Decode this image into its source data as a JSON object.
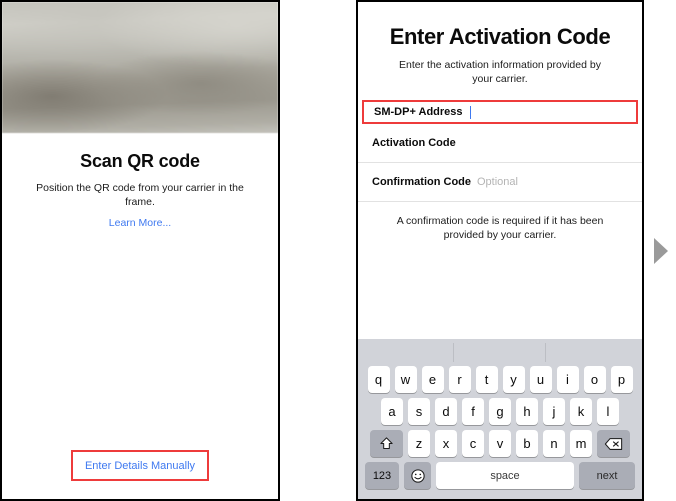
{
  "left_panel": {
    "camera": {
      "icon": "camera-preview",
      "alt": "blurred camera viewfinder"
    },
    "title": "Scan QR code",
    "description": "Position the QR code from your carrier in the frame.",
    "learn_more": "Learn More...",
    "manual_entry": "Enter Details Manually",
    "highlight_color": "#ee3b3b",
    "link_color": "#3f79f0"
  },
  "right_panel": {
    "title": "Enter Activation Code",
    "subtitle": "Enter the activation information provided by your carrier.",
    "fields": [
      {
        "label": "SM-DP+ Address",
        "value": "",
        "optional": "",
        "highlighted": true
      },
      {
        "label": "Activation Code",
        "value": "",
        "optional": "",
        "highlighted": false
      },
      {
        "label": "Confirmation Code",
        "value": "",
        "optional": "Optional",
        "highlighted": false
      }
    ],
    "note": "A confirmation code is required if it has been provided by your carrier.",
    "highlight_color": "#ee3b3b",
    "caret_color": "#3f79f0",
    "keyboard": {
      "suggestions": [
        "",
        "",
        ""
      ],
      "row1": [
        "q",
        "w",
        "e",
        "r",
        "t",
        "y",
        "u",
        "i",
        "o",
        "p"
      ],
      "row2": [
        "a",
        "s",
        "d",
        "f",
        "g",
        "h",
        "j",
        "k",
        "l"
      ],
      "row3": [
        "z",
        "x",
        "c",
        "v",
        "b",
        "n",
        "m"
      ],
      "shift_key": "shift-icon",
      "delete_key": "delete-icon",
      "numbers_key": "123",
      "emoji_key": "emoji-icon",
      "space_key": "space",
      "return_key": "next"
    }
  },
  "flow": {
    "arrow": "right-arrow-icon"
  }
}
